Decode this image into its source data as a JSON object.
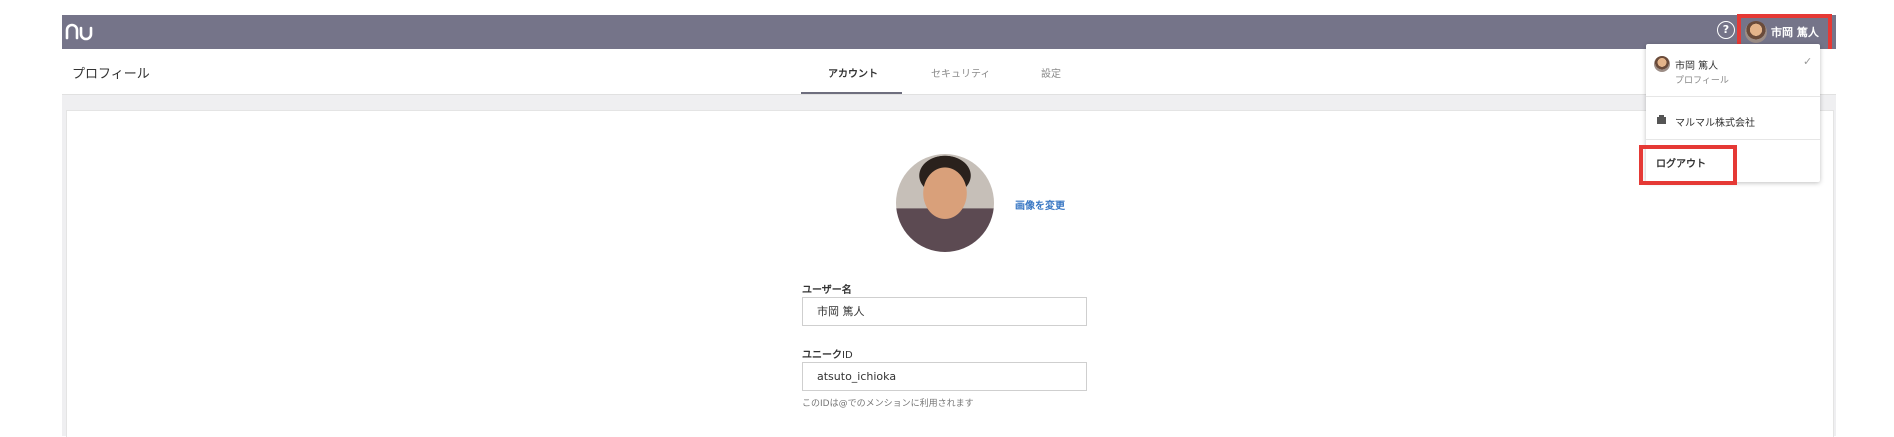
{
  "app": {
    "logo_text": "nu",
    "help_symbol": "?",
    "user_name": "市岡 篤人"
  },
  "subheader": {
    "page_title": "プロフィール",
    "tabs": [
      {
        "label": "アカウント",
        "active": true
      },
      {
        "label": "セキュリティ",
        "active": false
      },
      {
        "label": "設定",
        "active": false
      }
    ]
  },
  "profile": {
    "change_image_label": "画像を変更",
    "username_label": "ユーザー名",
    "username_value": "市岡 篤人",
    "unique_id_label_bold": "ユニーク",
    "unique_id_label_thin": "ID",
    "unique_id_value": "atsuto_ichioka",
    "unique_id_helper": "このIDは@でのメンションに利用されます"
  },
  "dropdown": {
    "user_name": "市岡 篤人",
    "user_sub": "プロフィール",
    "check_symbol": "✓",
    "company_name": "マルマル株式会社",
    "logout_label": "ログアウト"
  },
  "icons": {
    "logo": "nu-logo",
    "help": "help-circle-icon",
    "check": "check-icon",
    "company": "building-icon"
  },
  "colors": {
    "topbar": "#757489",
    "highlight": "#e53935",
    "link": "#3a78c4",
    "content_bg": "#efeff1"
  }
}
